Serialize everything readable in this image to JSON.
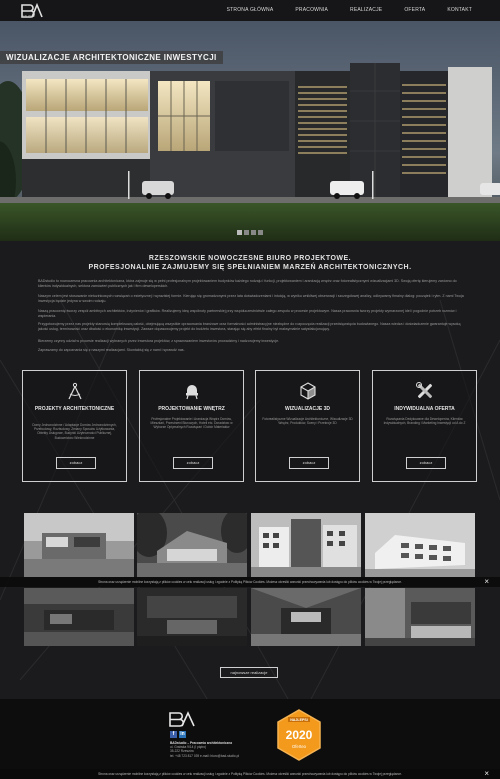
{
  "header": {
    "logo_text": "STUDIO",
    "nav": [
      "STRONA GŁÓWNA",
      "PRACOWNIA",
      "REALIZACJE",
      "OFERTA",
      "KONTAKT"
    ]
  },
  "hero": {
    "title": "WIZUALIZACJE ARCHITEKTONICZNE INWESTYCJI",
    "slides": 4,
    "active_slide": 1
  },
  "intro": {
    "headline_1": "RZESZOWSKIE NOWOCZESNE BIURO PROJEKTOWE.",
    "headline_2": "PROFESJONALNIE ZAJMUJEMY SIĘ SPEŁNIANIEM MARZEŃ ARCHITEKTONICZNYCH.",
    "paragraphs": [
      "BADstudio to nowoczesna pracownia architektoniczna, która zajmuje się w pełni profesjonalnym projektowaniem budynków każdego rodzaju i funkcji, projektowaniem i aranżacją wnętrz oraz fotorealistycznymi wizualizacjami 3D. Swoją ofertę kierujemy zarówno do klientów indywidualnych, sektora zamówień publicznych jak i firm deweloperskich.",
      "Naszym celem jest stosowanie nietuzinkowych rozwiązań o estetycznej i wyrazistej formie. Kierując się gromadzonymi przez lata doświadczeniami i intuicją, w wyniku wnikliwej obserwacji i szczegółowej analizy, odkrywamy fimalny dialog: początek i rytm. Z nami Twoja inwestycja będzie jedyna w swoim rodzaju.",
      "Naszą pracownię tworzy zespół ambitnych architektów, inżynierów i grafików. Realizujemy ideę wspólnoty partnerskiej przy współuczestnictwie całego zespołu w procesie projektowym. Nasza pracownia tworzy projekty wymarzonej idei i pogodnie potrzeb rozmów i wspierania.",
      "Przygotowujemy przez nas projekty stanowią kompleksową całość, obejmującą wszystkie opracowania branżowe oraz formalności administracyjne niezbędne do rozpoczęcia realizacji przedsięwzięcia budowlanego. Nasza wiedza i doświadczenie gwarantuje wysoką jakość usług, terminowość oraz dbałość o ekonomikę inwestycji. Zawsze dopasowujemy projekt do budżetu inwestora, starając się aby efekt finalny był maksymalnie satysfakcjonujący.",
      "Bierzemy czynny udział w procesie realizacji wybranych przez inwestora projektów, z sprawowaniem inwestorów prowadzimy i nadzorujemy inwestycje.",
      "Zapraszamy do zapoznania się z naszymi realizacjami. Skontaktuj się z nami i sprawdź nas."
    ]
  },
  "services": [
    {
      "title": "PROJEKTY ARCHITEKTONICZNE",
      "desc": "Domy Jednorodzinne / Adaptacje Domów Jednorodzinnych, Przebudowy, Rozbudowy, Zmiany Sposobu Użytkowania, Obiekty Usługowe, Budynki Użyteczności Publicznej, Budownictwo Wielorodzinne",
      "button": "zobacz",
      "icon": "compass-icon"
    },
    {
      "title": "PROJEKTOWANIE WNĘTRZ",
      "desc": "Profesjonalne Projektowanie i Aranżacja Wnętrz Domów, Mieszkań, Przestrzeni Biurowych, Hoteli etc. Doradztwo w Wyborze Optymalnych Rozwiązań i Dobór Materiałów",
      "button": "zobacz",
      "icon": "chair-icon"
    },
    {
      "title": "WIZUALIZACJE 3D",
      "desc": "Fotorealistyczne Wizualizacje Architektoniczne, Wizualizacje 3D Wnętrz, Produktów, Sceny i Przekroje 3D",
      "button": "zobacz",
      "icon": "cube-icon"
    },
    {
      "title": "INDYWIDUALNA OFERTA",
      "desc": "Rozwiązania Dedykowane dla Deweloperów, Klientów Indywidualnych, Branding i Marketing Inwestycji od A do Z",
      "button": "zobacz",
      "icon": "tools-icon"
    }
  ],
  "cookie": {
    "text": "Strona oraz urządzenie mobilne korzystają z plików cookies w celu realizacji usług i zgodnie z Polityką Plików Cookies. Możesz określić warunki przechowywania lub dostępu do plików cookies w Twojej przeglądarce.",
    "close": "×"
  },
  "gallery": {
    "button": "najnowsze realizacje"
  },
  "footer": {
    "company": "BADstudio – Pracownia architektoniczna",
    "address_1": "ul. Grabska 9/14 (I piętro)",
    "address_2": "35-222 Rzeszów",
    "contact": "tel. +48 723 817 039 e-mail: biuro@bad-studio.pl",
    "badge_top": "NAJLEPSI",
    "badge_year": "2020",
    "badge_bottom": "Oferteo",
    "social": [
      "f",
      "in"
    ]
  }
}
